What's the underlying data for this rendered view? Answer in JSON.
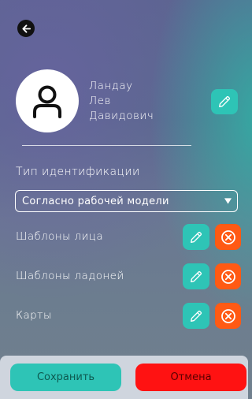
{
  "header": {
    "back_icon": "arrow-left-icon"
  },
  "profile": {
    "avatar_icon": "user-icon",
    "last_name": "Ландау",
    "first_name": "Лев",
    "patronymic": "Давидович",
    "edit_icon": "pencil-icon"
  },
  "identification": {
    "label": "Тип идентификации",
    "selected": "Согласно рабочей модели"
  },
  "rows": [
    {
      "label": "Шаблоны лица",
      "edit_icon": "pencil-icon",
      "remove_icon": "close-circle-icon"
    },
    {
      "label": "Шаблоны ладоней",
      "edit_icon": "pencil-icon",
      "remove_icon": "close-circle-icon"
    },
    {
      "label": "Карты",
      "edit_icon": "pencil-icon",
      "remove_icon": "close-circle-icon"
    }
  ],
  "footer": {
    "save_label": "Сохранить",
    "cancel_label": "Отмена"
  },
  "colors": {
    "accent": "#2ec4b6",
    "danger": "#ff5a14",
    "cancel": "#ff1212"
  }
}
